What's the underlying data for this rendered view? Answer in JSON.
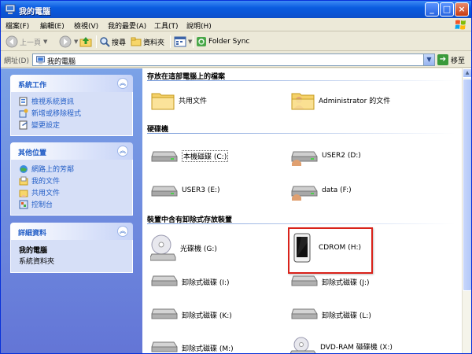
{
  "window": {
    "title": "我的電腦"
  },
  "menu": [
    {
      "label": "檔案(F)"
    },
    {
      "label": "編輯(E)"
    },
    {
      "label": "檢視(V)"
    },
    {
      "label": "我的最愛(A)"
    },
    {
      "label": "工具(T)"
    },
    {
      "label": "說明(H)"
    }
  ],
  "toolbar": {
    "back_label": "上一頁",
    "search_label": "搜尋",
    "folders_label": "資料夾",
    "folder_sync_label": "Folder Sync"
  },
  "address": {
    "label": "網址(D)",
    "value": "我的電腦",
    "go_label": "移至"
  },
  "sidebar": {
    "panels": [
      {
        "title": "系統工作",
        "links": [
          "檢視系統資訊",
          "新增或移除程式",
          "變更設定"
        ]
      },
      {
        "title": "其他位置",
        "links": [
          "網路上的芳鄰",
          "我的文件",
          "共用文件",
          "控制台"
        ]
      },
      {
        "title": "詳細資料",
        "detail_name": "我的電腦",
        "detail_desc": "系統資料夾"
      }
    ]
  },
  "content": {
    "groups": [
      {
        "title": "存放在這部電腦上的檔案",
        "items": [
          "共用文件",
          "Administrator 的文件"
        ]
      },
      {
        "title": "硬碟機",
        "items": [
          "本機磁碟 (C:)",
          "USER2 (D:)",
          "USER3 (E:)",
          "data (F:)"
        ]
      },
      {
        "title": "裝置中含有卸除式存放裝置",
        "items": [
          "光碟機 (G:)",
          "CDROM (H:)",
          "卸除式磁碟 (I:)",
          "卸除式磁碟 (J:)",
          "卸除式磁碟 (K:)",
          "卸除式磁碟 (L:)",
          "卸除式磁碟 (M:)",
          "DVD-RAM 磁碟機 (X:)"
        ]
      }
    ]
  },
  "colors": {
    "title_bar": "#0a55d6",
    "sidebar_bg": "#7ba2e7",
    "highlight_box": "#d9221a"
  }
}
